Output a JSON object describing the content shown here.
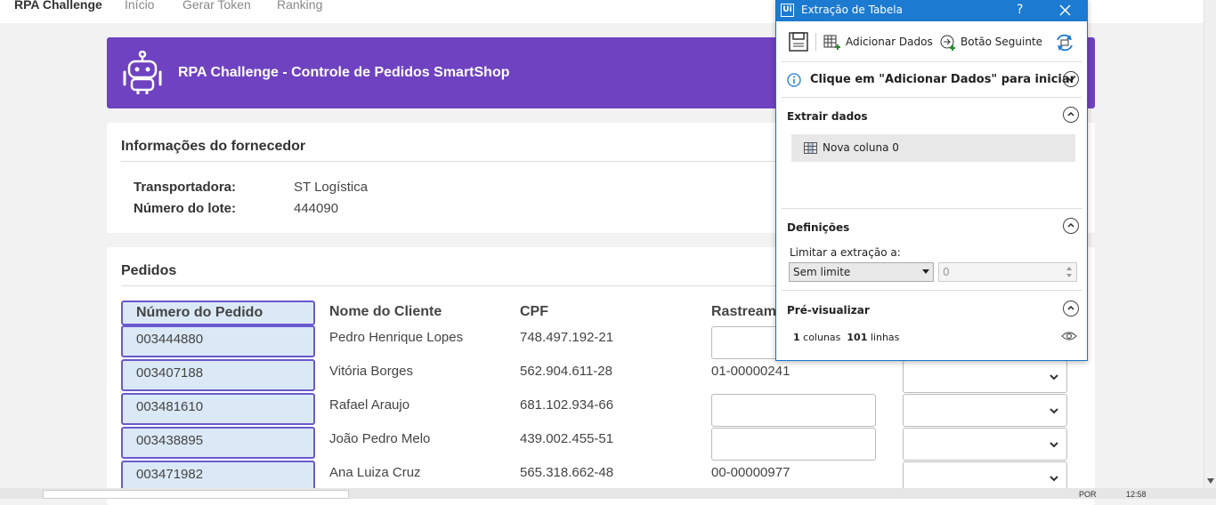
{
  "nav": {
    "brand": "RPA Challenge",
    "links": [
      "Início",
      "Gerar Token",
      "Ranking"
    ]
  },
  "banner": {
    "title": "RPA Challenge - Controle de Pedidos SmartShop"
  },
  "supplier": {
    "title": "Informações do fornecedor",
    "carrier_label": "Transportadora:",
    "carrier_value": "ST Logística",
    "batch_label": "Número do lote:",
    "batch_value": "444090"
  },
  "orders": {
    "title": "Pedidos",
    "headers": {
      "order_number": "Número do Pedido",
      "client_name": "Nome do Cliente",
      "cpf": "CPF",
      "tracking": "Rastreamento"
    },
    "rows": [
      {
        "order_number": "003444880",
        "client_name": "Pedro Henrique Lopes",
        "cpf": "748.497.192-21",
        "tracking": ""
      },
      {
        "order_number": "003407188",
        "client_name": "Vitória Borges",
        "cpf": "562.904.611-28",
        "tracking": "01-00000241"
      },
      {
        "order_number": "003481610",
        "client_name": "Rafael Araujo",
        "cpf": "681.102.934-66",
        "tracking": ""
      },
      {
        "order_number": "003438895",
        "client_name": "João Pedro Melo",
        "cpf": "439.002.455-51",
        "tracking": ""
      },
      {
        "order_number": "003471982",
        "client_name": "Ana Luiza Cruz",
        "cpf": "565.318.662-48",
        "tracking": "00-00000977"
      }
    ]
  },
  "dialog": {
    "title": "Extração de Tabela",
    "help": "?",
    "toolbar": {
      "add_data": "Adicionar Dados",
      "next_button": "Botão Seguinte"
    },
    "hint": "Clique em \"Adicionar Dados\" para iniciar",
    "extract_title": "Extrair dados",
    "column_item": "Nova coluna 0",
    "settings_title": "Definições",
    "limit_label": "Limitar a extração a:",
    "limit_option": "Sem limite",
    "limit_value": "0",
    "preview_title": "Pré-visualizar",
    "preview_columns_count": "1",
    "preview_columns_label": " colunas",
    "preview_rows_count": "101",
    "preview_rows_label": " linhas"
  },
  "taskbar": {
    "lang": "POR",
    "time": "12:58"
  },
  "colors": {
    "banner": "#6f42c1",
    "dialog_bar": "#1c7ad1",
    "order_cell_bg": "#dbe9f6",
    "order_cell_border": "#6a5acd"
  }
}
